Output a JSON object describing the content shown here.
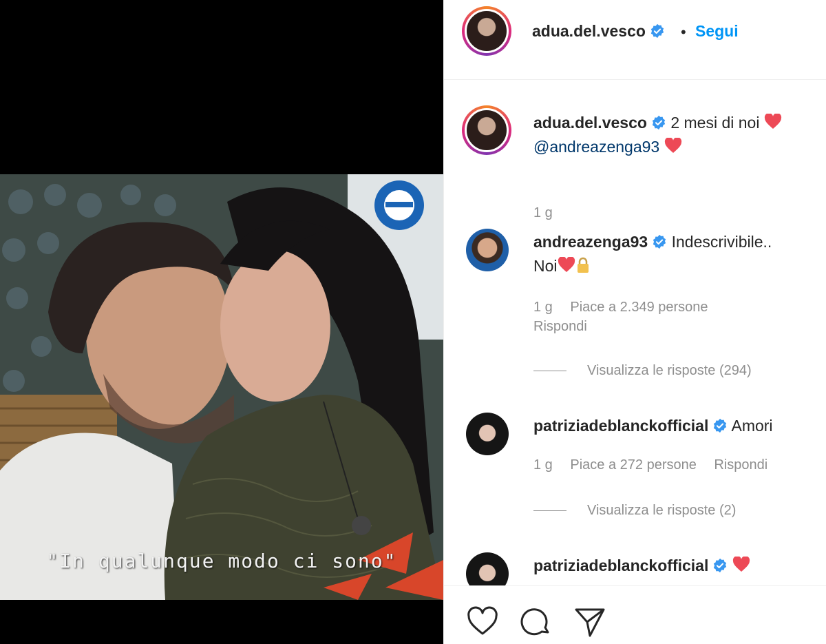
{
  "video": {
    "subtitle": "\"In qualunque modo ci sono\""
  },
  "header": {
    "username": "adua.del.vesco",
    "separator": "•",
    "follow_label": "Segui"
  },
  "caption": {
    "username": "adua.del.vesco",
    "text": "2 mesi di noi",
    "mention": "@andreazenga93",
    "time": "1 g"
  },
  "comments": [
    {
      "username": "andreazenga93",
      "text_line1": "Indescrivibile..",
      "text_line2": "Noi",
      "time": "1 g",
      "likes": "Piace a 2.349 persone",
      "reply_label": "Rispondi",
      "view_replies": "Visualizza le risposte (294)"
    },
    {
      "username": "patriziadeblanckofficial",
      "text": "Amori",
      "time": "1 g",
      "likes": "Piace a 272 persone",
      "reply_label": "Rispondi",
      "view_replies": "Visualizza le risposte (2)"
    },
    {
      "username": "patriziadeblanckofficial",
      "text": ""
    }
  ],
  "actions": [
    "heart-icon",
    "comment-icon",
    "share-icon"
  ],
  "colors": {
    "accent": "#0095f6",
    "verified": "#3897f0",
    "heart": "#ed4956",
    "muted": "#8e8e8e",
    "text": "#262626"
  }
}
